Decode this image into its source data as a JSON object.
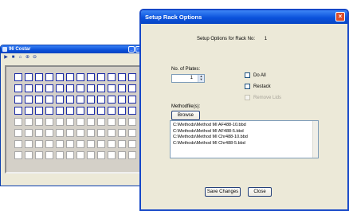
{
  "rack_window": {
    "title": "96 Costar",
    "icons": [
      "play-icon",
      "stop-icon",
      "home-icon",
      "zoom-in-icon",
      "zoom-out-icon"
    ],
    "plate": {
      "rows": 8,
      "columns": 12,
      "selected_rows": 4
    }
  },
  "dialog": {
    "title": "Setup Rack Options",
    "rack_label": "Setup Options for Rack No:",
    "rack_number": "1",
    "plates_label": "No. of Plates:",
    "plates_value": "1",
    "checkboxes": [
      {
        "label": "Do All",
        "checked": false,
        "enabled": true
      },
      {
        "label": "Restack",
        "checked": false,
        "enabled": true
      },
      {
        "label": "Remove Lids",
        "checked": false,
        "enabled": false
      }
    ],
    "methods_label": "Methodfile(s):",
    "browse_label": "Browse",
    "method_files": [
      "C:\\Methods\\Method MI AF488-10.bbd",
      "C:\\Methods\\Method MI AF488-5.bbd",
      "C:\\Methods\\Method MI Chr488-10.bbd",
      "C:\\Methods\\Method MI Chr488-5.bbd"
    ],
    "save_label": "Save Changes",
    "close_label": "Close"
  }
}
